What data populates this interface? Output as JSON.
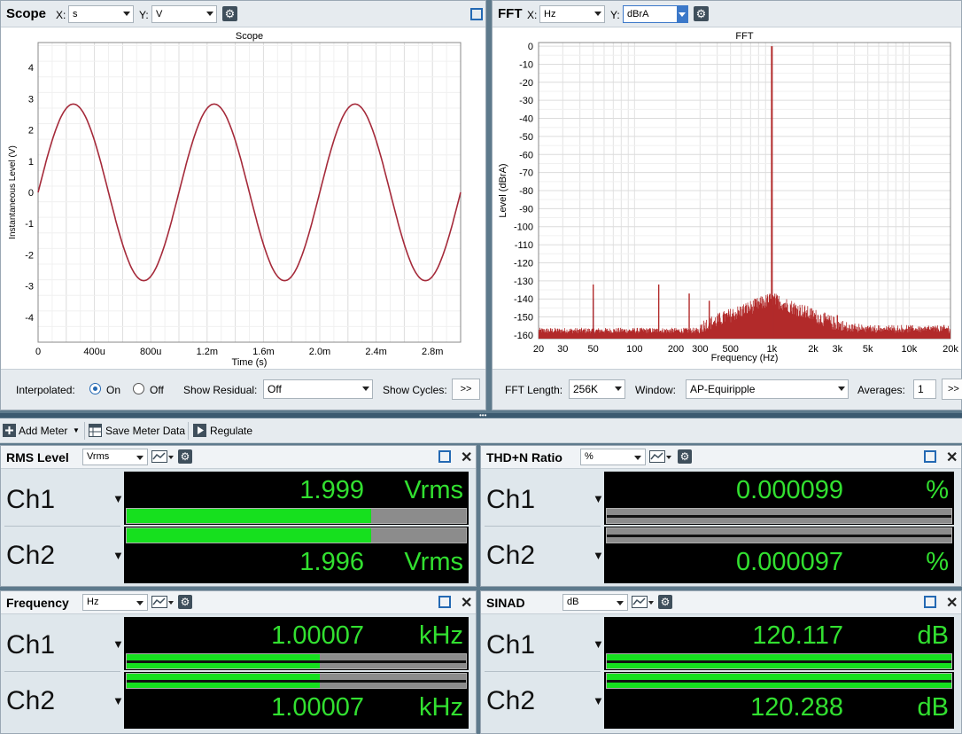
{
  "scope": {
    "title": "Scope",
    "x_label": "X:",
    "x_unit": "s",
    "y_label": "Y:",
    "y_unit": "V",
    "interpolated_label": "Interpolated:",
    "on_label": "On",
    "off_label": "Off",
    "interpolated_value": "On",
    "show_residual_label": "Show Residual:",
    "show_residual_value": "Off",
    "show_cycles_label": "Show Cycles:",
    "cycles_button": ">>"
  },
  "fft": {
    "title": "FFT",
    "x_label": "X:",
    "x_unit": "Hz",
    "y_label": "Y:",
    "y_unit": "dBrA",
    "fft_length_label": "FFT Length:",
    "fft_length_value": "256K",
    "window_label": "Window:",
    "window_value": "AP-Equiripple",
    "averages_label": "Averages:",
    "averages_value": "1",
    "more_button": ">>"
  },
  "toolbar": {
    "add_meter": "Add Meter",
    "save_meter_data": "Save Meter Data",
    "regulate": "Regulate"
  },
  "meters": {
    "rms": {
      "title": "RMS Level",
      "unit_select": "Vrms",
      "ch1": {
        "label": "Ch1",
        "value": "1.999",
        "unit": "Vrms",
        "bar_fraction": 0.72
      },
      "ch2": {
        "label": "Ch2",
        "value": "1.996",
        "unit": "Vrms",
        "bar_fraction": 0.72
      }
    },
    "thdn": {
      "title": "THD+N Ratio",
      "unit_select": "%",
      "ch1": {
        "label": "Ch1",
        "value": "0.000099",
        "unit": "%",
        "bar_fraction": 0.0
      },
      "ch2": {
        "label": "Ch2",
        "value": "0.000097",
        "unit": "%",
        "bar_fraction": 0.0
      }
    },
    "freq": {
      "title": "Frequency",
      "unit_select": "Hz",
      "ch1": {
        "label": "Ch1",
        "value": "1.00007",
        "unit": "kHz",
        "bar_fraction": 0.57
      },
      "ch2": {
        "label": "Ch2",
        "value": "1.00007",
        "unit": "kHz",
        "bar_fraction": 0.57
      }
    },
    "sinad": {
      "title": "SINAD",
      "unit_select": "dB",
      "ch1": {
        "label": "Ch1",
        "value": "120.117",
        "unit": "dB",
        "bar_fraction": 1.0
      },
      "ch2": {
        "label": "Ch2",
        "value": "120.288",
        "unit": "dB",
        "bar_fraction": 1.0
      }
    }
  },
  "chart_data": [
    {
      "type": "line",
      "title": "Scope",
      "xlabel": "Time (s)",
      "ylabel": "Instantaneous Level (V)",
      "xlim": [
        0,
        0.003
      ],
      "ylim": [
        -4.8,
        4.8
      ],
      "x_tick_labels": [
        "0",
        "400u",
        "800u",
        "1.2m",
        "1.6m",
        "2.0m",
        "2.4m",
        "2.8m"
      ],
      "x_tick_values": [
        0,
        0.0004,
        0.0008,
        0.0012,
        0.0016,
        0.002,
        0.0024,
        0.0028
      ],
      "y_ticks": [
        -4,
        -3,
        -2,
        -1,
        0,
        1,
        2,
        3,
        4
      ],
      "grid": true,
      "series": [
        {
          "amplitude": 2.83,
          "frequency_hz": 1000,
          "color": "#a52a3a"
        }
      ]
    },
    {
      "type": "line",
      "title": "FFT",
      "xlabel": "Frequency (Hz)",
      "ylabel": "Level (dBrA)",
      "x_scale": "log",
      "xlim": [
        20,
        20000
      ],
      "ylim": [
        -162,
        2
      ],
      "x_tick_labels": [
        "20",
        "30",
        "50",
        "100",
        "200",
        "300",
        "500",
        "1k",
        "2k",
        "3k",
        "5k",
        "10k",
        "20k"
      ],
      "x_tick_values": [
        20,
        30,
        50,
        100,
        200,
        300,
        500,
        1000,
        2000,
        3000,
        5000,
        10000,
        20000
      ],
      "y_ticks": [
        0,
        -10,
        -20,
        -30,
        -40,
        -50,
        -60,
        -70,
        -80,
        -90,
        -100,
        -110,
        -120,
        -130,
        -140,
        -150,
        -160
      ],
      "grid": true,
      "noise_floor": -160,
      "series": [
        {
          "color": "#b22a2a",
          "peaks": [
            [
              1000,
              0
            ],
            [
              50,
              -132
            ],
            [
              150,
              -132
            ],
            [
              250,
              -137
            ],
            [
              350,
              -141
            ],
            [
              450,
              -148
            ],
            [
              2000,
              -150
            ],
            [
              3000,
              -149
            ],
            [
              4000,
              -155
            ],
            [
              5000,
              -155
            ]
          ]
        },
        {
          "color": "#3a5fb0",
          "peaks": [
            [
              1000,
              -5
            ],
            [
              50,
              -140
            ]
          ]
        }
      ]
    }
  ],
  "colors": {
    "accent": "#2469b3",
    "meter_green": "#32e030",
    "trace": "#a52a3a"
  }
}
